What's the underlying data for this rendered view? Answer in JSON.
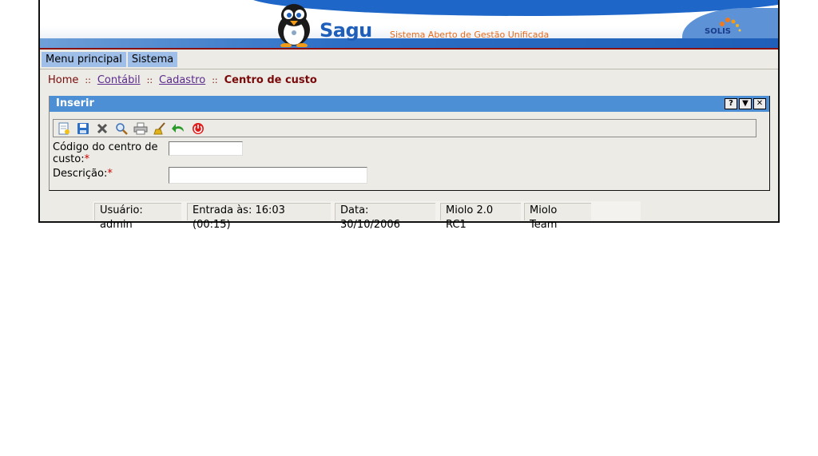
{
  "banner": {
    "brand": "Sagu",
    "tagline": "Sistema Aberto de Gestão Unificada",
    "partner_logo": "SOLIS"
  },
  "menu": {
    "items": [
      {
        "label": "Menu principal"
      },
      {
        "label": "Sistema"
      }
    ]
  },
  "breadcrumb": {
    "home": "Home",
    "separator": "::",
    "items": [
      "Contábil",
      "Cadastro"
    ],
    "current": "Centro de custo"
  },
  "panel": {
    "title": "Inserir",
    "window_buttons": [
      "?",
      "▼",
      "✕"
    ],
    "toolbar_icons": [
      "new-icon",
      "save-icon",
      "delete-icon",
      "search-icon",
      "print-icon",
      "clear-icon",
      "back-icon",
      "exit-icon"
    ]
  },
  "form": {
    "codigo_label": "Código do centro de custo:",
    "descricao_label": "Descrição:",
    "required_mark": "*",
    "codigo_value": "",
    "descricao_value": ""
  },
  "status": {
    "user": "Usuário: admin",
    "login": "Entrada às: 16:03 (00:15)",
    "date": "Data: 30/10/2006",
    "version": "Miolo 2.0 RC1",
    "team": "Miolo Team"
  },
  "colors": {
    "accent": "#4c8fd4",
    "menu": "#9fbfe9",
    "breadcrumb": "#7a0a0a",
    "required": "#cc0000"
  }
}
